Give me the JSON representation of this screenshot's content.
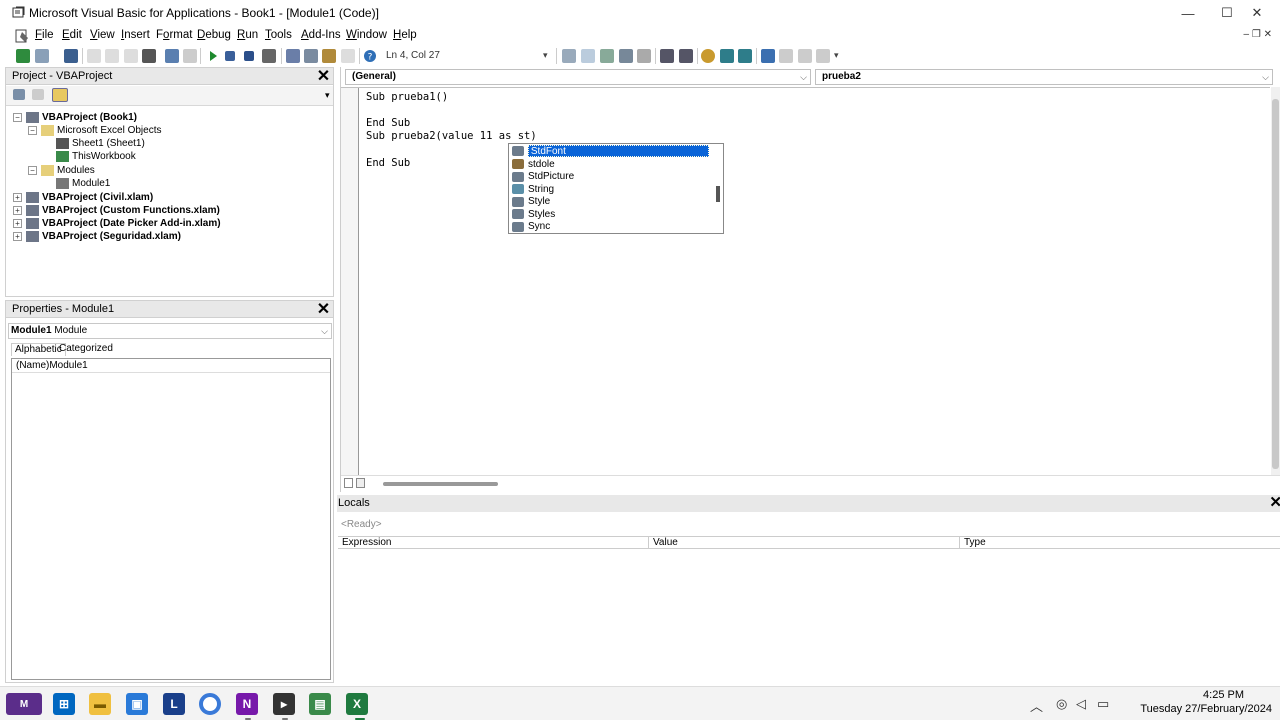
{
  "window": {
    "title": "Microsoft Visual Basic for Applications - Book1 - [Module1 (Code)]",
    "minimize": "—",
    "maximize": "☐",
    "close": "✕"
  },
  "menu": {
    "items": [
      {
        "pre": "",
        "ul": "F",
        "post": "ile"
      },
      {
        "pre": "",
        "ul": "E",
        "post": "dit"
      },
      {
        "pre": "",
        "ul": "V",
        "post": "iew"
      },
      {
        "pre": "",
        "ul": "I",
        "post": "nsert"
      },
      {
        "pre": "F",
        "ul": "o",
        "post": "rmat"
      },
      {
        "pre": "",
        "ul": "D",
        "post": "ebug"
      },
      {
        "pre": "",
        "ul": "R",
        "post": "un"
      },
      {
        "pre": "",
        "ul": "T",
        "post": "ools"
      },
      {
        "pre": "",
        "ul": "A",
        "post": "dd-Ins"
      },
      {
        "pre": "",
        "ul": "W",
        "post": "indow"
      },
      {
        "pre": "",
        "ul": "H",
        "post": "elp"
      }
    ],
    "mdi_controls": "–  ❐  ✕"
  },
  "toolbar": {
    "position": "Ln 4, Col 27"
  },
  "project": {
    "title": "Project - VBAProject",
    "close": "✕",
    "tree": [
      {
        "label": "VBAProject (Book1)",
        "bold": true
      },
      {
        "label": "Microsoft Excel Objects",
        "bold": false
      },
      {
        "label": "Sheet1 (Sheet1)",
        "bold": false
      },
      {
        "label": "ThisWorkbook",
        "bold": false
      },
      {
        "label": "Modules",
        "bold": false
      },
      {
        "label": "Module1",
        "bold": false
      },
      {
        "label": "VBAProject (Civil.xlam)",
        "bold": true
      },
      {
        "label": "VBAProject (Custom Functions.xlam)",
        "bold": true
      },
      {
        "label": "VBAProject (Date Picker Add-in.xlam)",
        "bold": true
      },
      {
        "label": "VBAProject (Seguridad.xlam)",
        "bold": true
      }
    ]
  },
  "properties": {
    "title": "Properties - Module1",
    "close": "✕",
    "object_name": "Module1",
    "object_type": "Module",
    "tabs": [
      "Alphabetic",
      "Categorized"
    ],
    "rows": [
      {
        "name": "(Name)",
        "value": "Module1"
      }
    ]
  },
  "code": {
    "object_combo": "(General)",
    "proc_combo": "prueba2",
    "lines": [
      "Sub prueba1()",
      "",
      "End Sub",
      "Sub prueba2(value 11 as st)",
      "",
      "End Sub"
    ]
  },
  "autocomplete": {
    "items": [
      {
        "label": "StdFont",
        "icon": "class-icon",
        "color": "#6b7b8c"
      },
      {
        "label": "stdole",
        "icon": "library-icon",
        "color": "#8a6d3b"
      },
      {
        "label": "StdPicture",
        "icon": "class-icon",
        "color": "#6b7b8c"
      },
      {
        "label": "String",
        "icon": "type-icon",
        "color": "#5a8fa8"
      },
      {
        "label": "Style",
        "icon": "class-icon",
        "color": "#6b7b8c"
      },
      {
        "label": "Styles",
        "icon": "class-icon",
        "color": "#6b7b8c"
      },
      {
        "label": "Sync",
        "icon": "class-icon",
        "color": "#6b7b8c"
      }
    ],
    "selected_index": 0
  },
  "locals": {
    "title": "Locals",
    "status": "<Ready>",
    "columns": [
      "Expression",
      "Value",
      "Type"
    ],
    "close": "✕"
  },
  "taskbar": {
    "time": "4:25 PM",
    "date": "Tuesday 27/February/2024",
    "apps": [
      "start",
      "file-explorer",
      "store",
      "l-app",
      "chrome",
      "onenote",
      "vba-editor",
      "notepad",
      "excel"
    ]
  },
  "colors": {
    "selection": "#0a64d8",
    "panel_header": "#e8e8e8"
  }
}
